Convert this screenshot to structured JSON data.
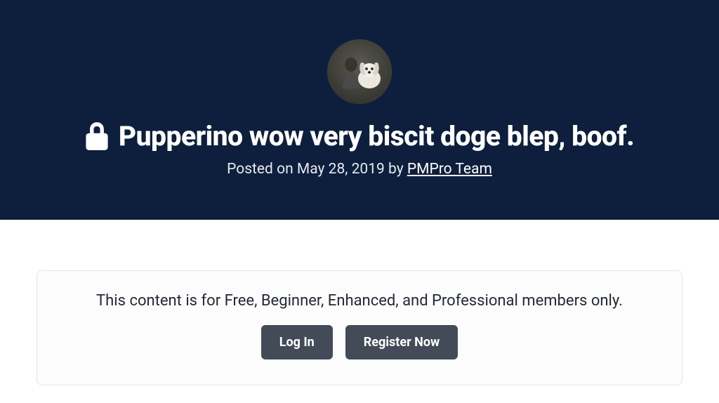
{
  "hero": {
    "title": "Pupperino wow very biscit doge blep, boof.",
    "meta_prefix": "Posted on ",
    "date": "May 28, 2019",
    "meta_by": " by ",
    "author": "PMPro Team"
  },
  "paywall": {
    "message": "This content is for Free, Beginner, Enhanced, and Professional members only.",
    "login_label": "Log In",
    "register_label": "Register Now"
  }
}
